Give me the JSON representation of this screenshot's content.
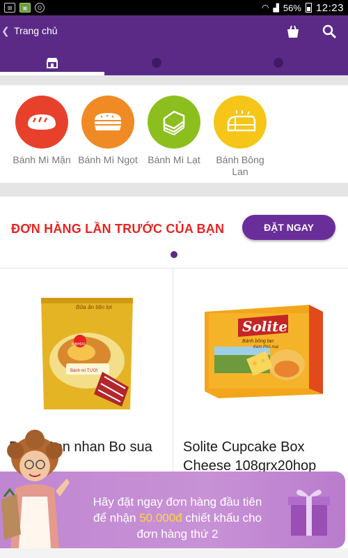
{
  "status_bar": {
    "battery": "56%",
    "time": "12:23"
  },
  "app_bar": {
    "title": "Trang chủ"
  },
  "categories": [
    {
      "label": "Bánh Mì Mặn",
      "color": "#e8412b",
      "icon": "bread-loaf-icon"
    },
    {
      "label": "Bánh Mì Ngọt",
      "color": "#f08a24",
      "icon": "sandwich-icon"
    },
    {
      "label": "Bánh Mì Lạt",
      "color": "#8cbf1e",
      "icon": "bread-slices-icon"
    },
    {
      "label": "Bánh Bông Lan",
      "color": "#f5c518",
      "icon": "sponge-cake-icon"
    }
  ],
  "section": {
    "title": "ĐƠN HÀNG LẦN TRƯỚC CỦA BẠN",
    "button": "ĐẶT NGAY"
  },
  "products": [
    {
      "name": "Banh Bon nhan Bo sua",
      "package_text_1": "Bữa ăn tiện lợi",
      "package_text_2": "Bánh mì TƯƠI",
      "brand": "KINHDO"
    },
    {
      "name": "Solite Cupcake Box Cheese 108grx20hop",
      "brand": "Solite",
      "package_text_1": "Bánh bông lan",
      "package_text_2": "Kem Phô mai"
    }
  ],
  "banner": {
    "line1": "Hãy đặt ngay đơn hàng đầu tiên",
    "line2_pre": "để nhận ",
    "amount": "50.000đ",
    "line2_post": " chiết khấu cho",
    "line3": "đơn hàng thứ 2"
  },
  "colors": {
    "primary": "#5b2a86",
    "accent_red": "#e52521",
    "banner": "#c48cd4",
    "highlight": "#ffd83b"
  }
}
